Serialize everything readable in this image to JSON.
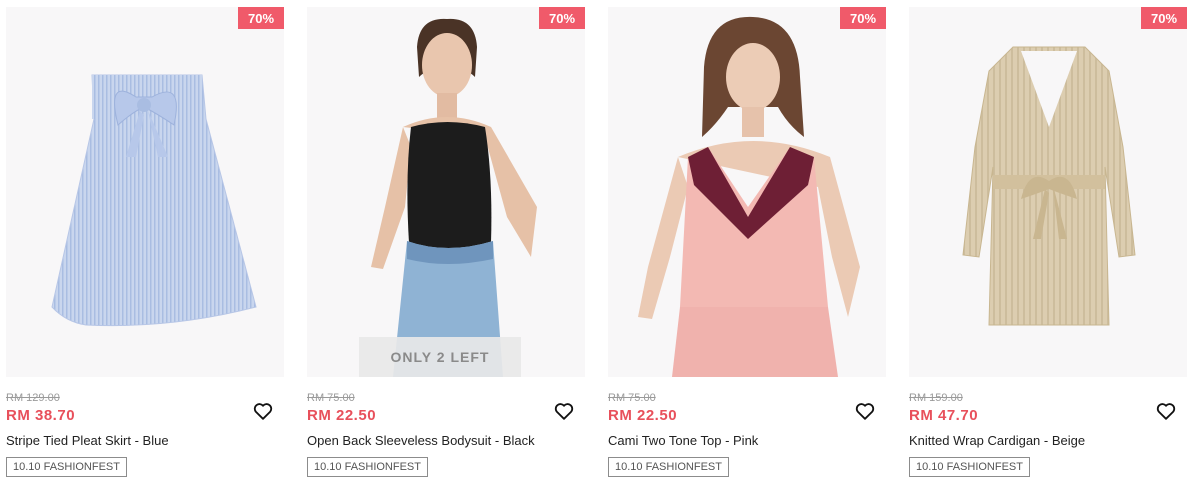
{
  "products": [
    {
      "discount": "70%",
      "old_price": "RM 129.00",
      "new_price": "RM 38.70",
      "name": "Stripe Tied Pleat Skirt - Blue",
      "tag": "10.10 FASHIONFEST",
      "stock_note": ""
    },
    {
      "discount": "70%",
      "old_price": "RM 75.00",
      "new_price": "RM 22.50",
      "name": "Open Back Sleeveless Bodysuit - Black",
      "tag": "10.10 FASHIONFEST",
      "stock_note": "ONLY 2 LEFT"
    },
    {
      "discount": "70%",
      "old_price": "RM 75.00",
      "new_price": "RM 22.50",
      "name": "Cami Two Tone Top - Pink",
      "tag": "10.10 FASHIONFEST",
      "stock_note": ""
    },
    {
      "discount": "70%",
      "old_price": "RM 159.00",
      "new_price": "RM 47.70",
      "name": "Knitted Wrap Cardigan - Beige",
      "tag": "10.10 FASHIONFEST",
      "stock_note": ""
    }
  ],
  "icons": {
    "wishlist": "heart-outline-icon"
  },
  "colors": {
    "discount_badge": "#f05a6a",
    "sale_price": "#e8505b",
    "old_price": "#9a9a9a"
  }
}
